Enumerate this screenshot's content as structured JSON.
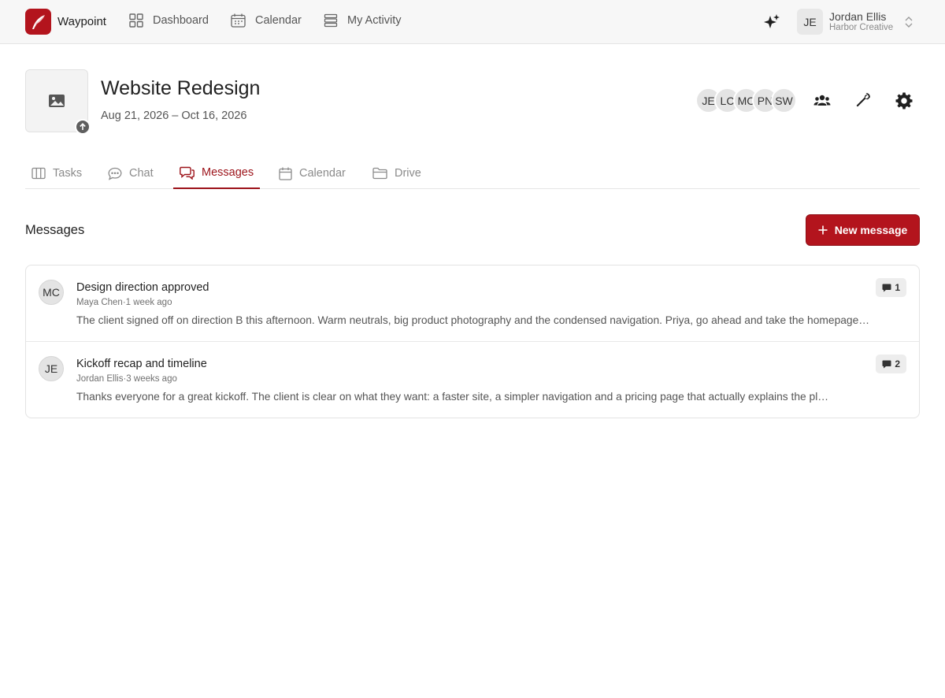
{
  "app": {
    "name": "Waypoint"
  },
  "nav": {
    "items": [
      {
        "label": "Dashboard",
        "icon": "dashboard-grid-icon"
      },
      {
        "label": "Calendar",
        "icon": "calendar-icon"
      },
      {
        "label": "My Activity",
        "icon": "activity-list-icon"
      }
    ]
  },
  "user": {
    "initials": "JE",
    "name": "Jordan Ellis",
    "org": "Harbor Creative"
  },
  "project": {
    "title": "Website Redesign",
    "dates": "Aug 21, 2026 – Oct 16, 2026",
    "members": [
      "JE",
      "LC",
      "MC",
      "PN",
      "SW"
    ]
  },
  "tabs": [
    {
      "label": "Tasks",
      "icon": "board-columns-icon",
      "active": false
    },
    {
      "label": "Chat",
      "icon": "chat-bubble-icon",
      "active": false
    },
    {
      "label": "Messages",
      "icon": "messages-icon",
      "active": true
    },
    {
      "label": "Calendar",
      "icon": "calendar-icon",
      "active": false
    },
    {
      "label": "Drive",
      "icon": "folder-icon",
      "active": false
    }
  ],
  "messages_section": {
    "title": "Messages",
    "new_label": "New message"
  },
  "messages": [
    {
      "initials": "MC",
      "title": "Design direction approved",
      "author": "Maya Chen",
      "time": "1 week ago",
      "preview": "The client signed off on direction B this afternoon. Warm neutrals, big product photography and the condensed navigation. Priya, go ahead and take the homepage…",
      "comments": "1"
    },
    {
      "initials": "JE",
      "title": "Kickoff recap and timeline",
      "author": "Jordan Ellis",
      "time": "3 weeks ago",
      "preview": "Thanks everyone for a great kickoff. The client is clear on what they want: a faster site, a simpler navigation and a pricing page that actually explains the pl…",
      "comments": "2"
    }
  ],
  "colors": {
    "accent": "#b3141d",
    "accent_dark": "#9c1219"
  }
}
